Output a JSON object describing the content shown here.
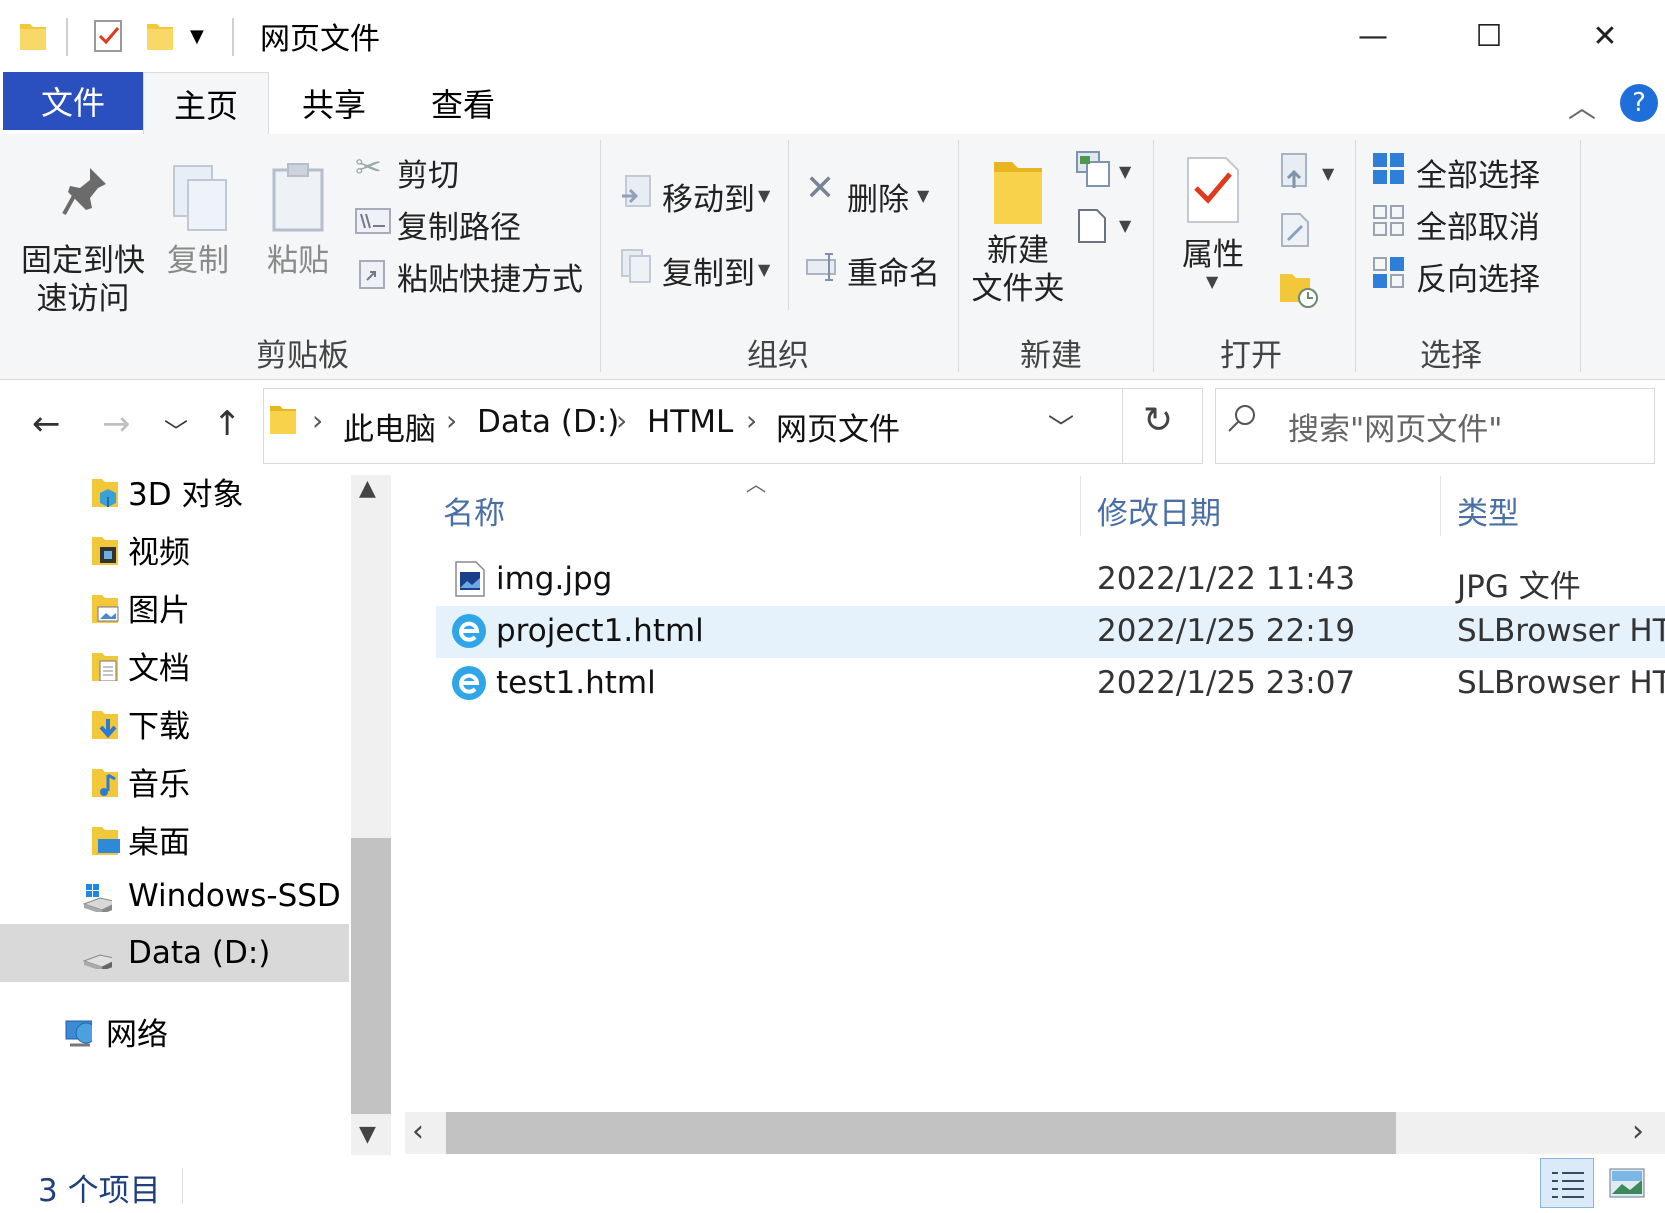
{
  "window": {
    "title": "网页文件",
    "minimize": "—",
    "maximize": "☐",
    "close": "✕"
  },
  "ribbon_tabs": {
    "file": "文件",
    "home": "主页",
    "share": "共享",
    "view": "查看"
  },
  "help": "?",
  "clipboard": {
    "group": "剪贴板",
    "pin": "固定到快\n速访问",
    "pin_line1": "固定到快",
    "pin_line2": "速访问",
    "copy": "复制",
    "paste": "粘贴",
    "cut": "剪切",
    "copy_path": "复制路径",
    "paste_shortcut": "粘贴快捷方式"
  },
  "organize": {
    "group": "组织",
    "move_to": "移动到",
    "copy_to": "复制到",
    "delete": "删除",
    "rename": "重命名"
  },
  "new": {
    "group": "新建",
    "new_folder_line1": "新建",
    "new_folder_line2": "文件夹"
  },
  "open": {
    "group": "打开",
    "properties": "属性"
  },
  "select": {
    "group": "选择",
    "select_all": "全部选择",
    "select_none": "全部取消",
    "invert": "反向选择"
  },
  "address": {
    "crumbs": [
      "此电脑",
      "Data (D:)",
      "HTML",
      "网页文件"
    ],
    "search_placeholder": "搜索\"网页文件\""
  },
  "nav_pane": {
    "items": [
      {
        "label": "3D 对象",
        "icon": "3d-objects-icon"
      },
      {
        "label": "视频",
        "icon": "video-folder-icon"
      },
      {
        "label": "图片",
        "icon": "pictures-folder-icon"
      },
      {
        "label": "文档",
        "icon": "documents-folder-icon"
      },
      {
        "label": "下载",
        "icon": "downloads-folder-icon"
      },
      {
        "label": "音乐",
        "icon": "music-folder-icon"
      },
      {
        "label": "桌面",
        "icon": "desktop-folder-icon"
      },
      {
        "label": "Windows-SSD (",
        "icon": "windows-drive-icon"
      },
      {
        "label": "Data (D:)",
        "icon": "drive-icon"
      }
    ],
    "network": "网络"
  },
  "file_list": {
    "columns": {
      "name": "名称",
      "date": "修改日期",
      "type": "类型"
    },
    "rows": [
      {
        "name": "img.jpg",
        "date": "2022/1/22 11:43",
        "type": "JPG 文件",
        "icon": "image-file-icon"
      },
      {
        "name": "project1.html",
        "date": "2022/1/25 22:19",
        "type": "SLBrowser HTM",
        "icon": "slbrowser-html-icon"
      },
      {
        "name": "test1.html",
        "date": "2022/1/25 23:07",
        "type": "SLBrowser HTM",
        "icon": "slbrowser-html-icon"
      }
    ]
  },
  "status": {
    "count": "3 个项目"
  },
  "colors": {
    "file_tab": "#2a4fbf",
    "selection": "#e5f1fb",
    "header_text": "#4a6fa5",
    "folder": "#f3c73a"
  }
}
